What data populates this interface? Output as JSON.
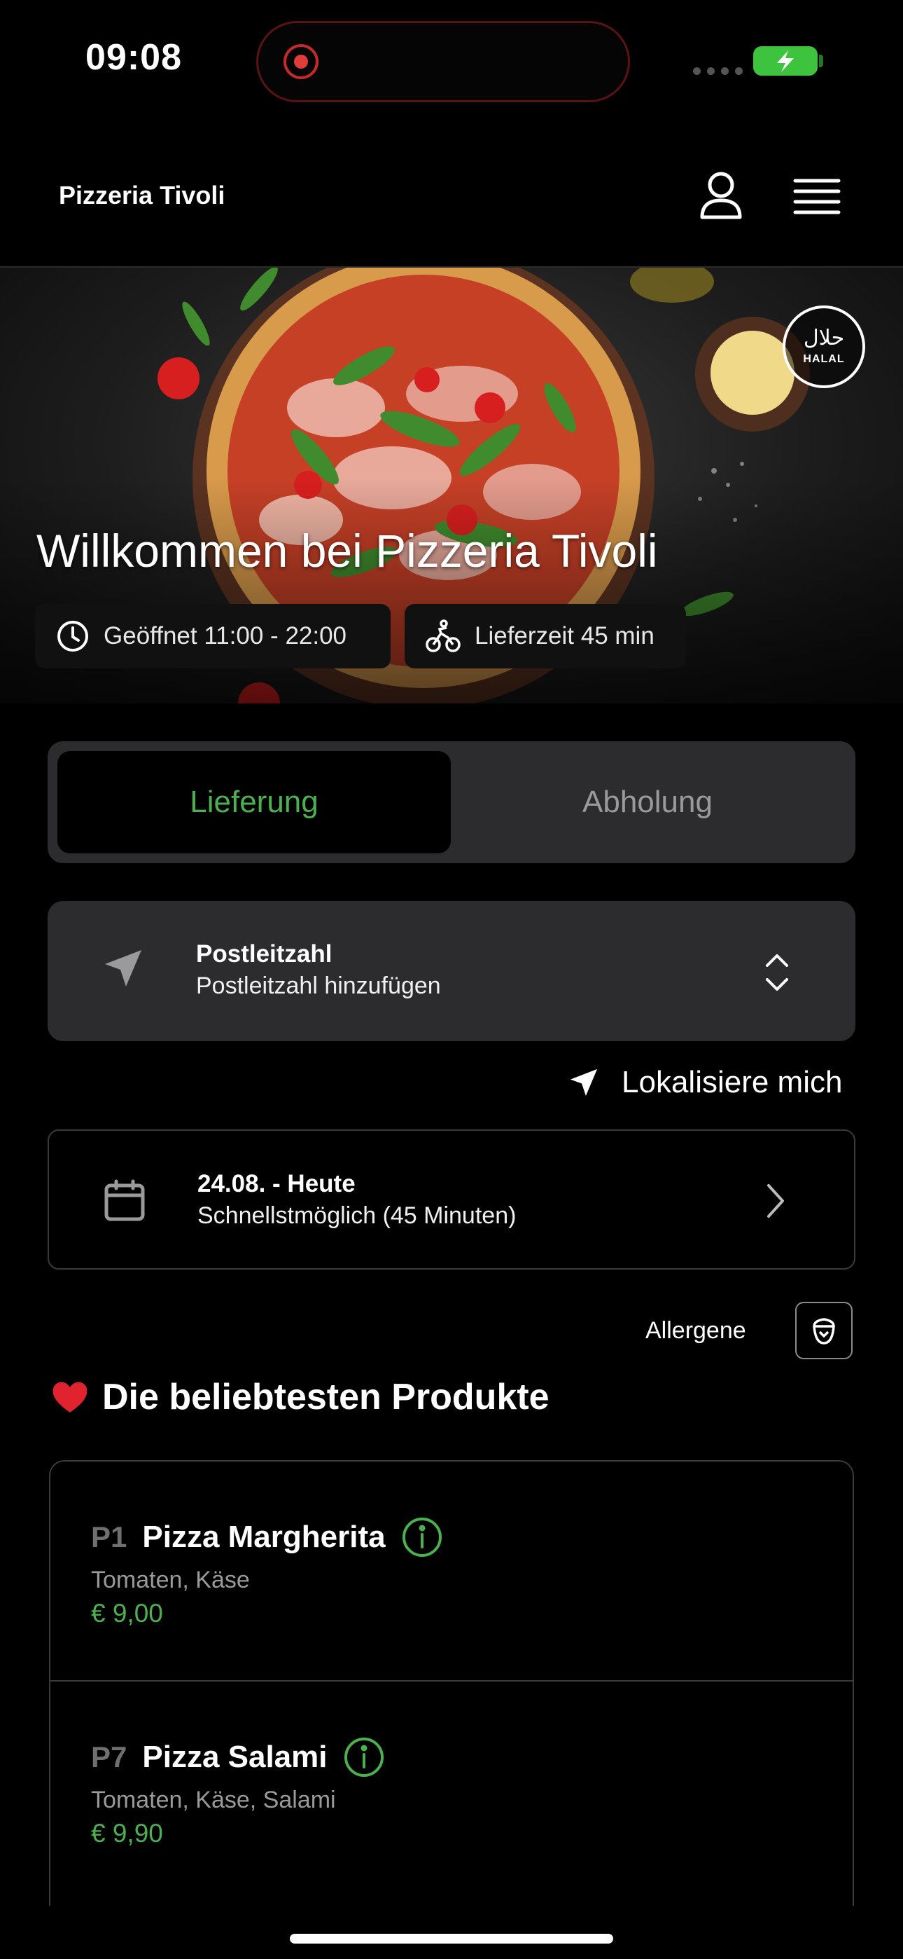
{
  "status_bar": {
    "time": "09:08"
  },
  "header": {
    "brand": "Pizzeria Tivoli"
  },
  "hero": {
    "title": "Willkommen bei Pizzeria Tivoli",
    "opening_hours": "Geöffnet 11:00 - 22:00",
    "delivery_time": "Lieferzeit 45 min",
    "badge_arabic": "حلال",
    "badge_label": "HALAL"
  },
  "toggle": {
    "active": "Lieferung",
    "other": "Abholung"
  },
  "postal": {
    "title": "Postleitzahl",
    "subtitle": "Postleitzahl hinzufügen"
  },
  "locate_label": "Lokalisiere mich",
  "schedule": {
    "date": "24.08. - Heute",
    "time": "Schnellstmöglich (45 Minuten)"
  },
  "allergens_label": "Allergene",
  "section_title": "Die beliebtesten Produkte",
  "products": [
    {
      "code": "P1",
      "name": "Pizza Margherita",
      "ingredients": "Tomaten, Käse",
      "price": "€ 9,00"
    },
    {
      "code": "P7",
      "name": "Pizza Salami",
      "ingredients": "Tomaten, Käse, Salami",
      "price": "€ 9,90"
    }
  ],
  "colors": {
    "accent": "#4cb050",
    "card": "#2c2c2e",
    "background": "#000000"
  }
}
